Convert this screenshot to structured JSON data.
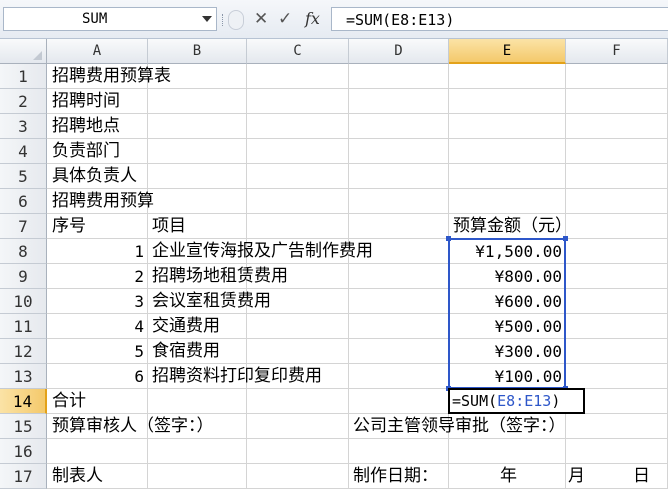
{
  "formula_bar": {
    "name_box": "SUM",
    "cancel_icon": "✕",
    "enter_icon": "✓",
    "fx_label": "fx",
    "formula": "=SUM(E8:E13)"
  },
  "columns": [
    "A",
    "B",
    "C",
    "D",
    "E",
    "F"
  ],
  "rows": [
    "1",
    "2",
    "3",
    "4",
    "5",
    "6",
    "7",
    "8",
    "9",
    "10",
    "11",
    "12",
    "13",
    "14",
    "15",
    "16",
    "17"
  ],
  "cells": {
    "r1_a": "招聘费用预算表",
    "r2_a": "招聘时间",
    "r3_a": "招聘地点",
    "r4_a": "负责部门",
    "r5_a": "具体负责人",
    "r6_a": "招聘费用预算",
    "r7_a": "序号",
    "r7_b": "项目",
    "r7_e": "预算金额（元）",
    "items": [
      {
        "no": "1",
        "name": "企业宣传海报及广告制作费用",
        "amount": "¥1,500.00"
      },
      {
        "no": "2",
        "name": "招聘场地租赁费用",
        "amount": "¥800.00"
      },
      {
        "no": "3",
        "name": "会议室租赁费用",
        "amount": "¥600.00"
      },
      {
        "no": "4",
        "name": "交通费用",
        "amount": "¥500.00"
      },
      {
        "no": "5",
        "name": "食宿费用",
        "amount": "¥300.00"
      },
      {
        "no": "6",
        "name": "招聘资料打印复印费用",
        "amount": "¥100.00"
      }
    ],
    "r14_a": "合计",
    "r14_e_prefix": "=SUM(",
    "r14_e_ref": "E8:E13",
    "r14_e_suffix": ")",
    "r15_a": "预算审核人（签字：）",
    "r15_d": "公司主管领导审批（签字：）",
    "r17_a": "制表人",
    "r17_d": "制作日期：",
    "r17_year": "年",
    "r17_month": "月",
    "r17_day": "日"
  },
  "colors": {
    "selection_border": "#2e57c9",
    "header_highlight": "#f4c96b"
  }
}
